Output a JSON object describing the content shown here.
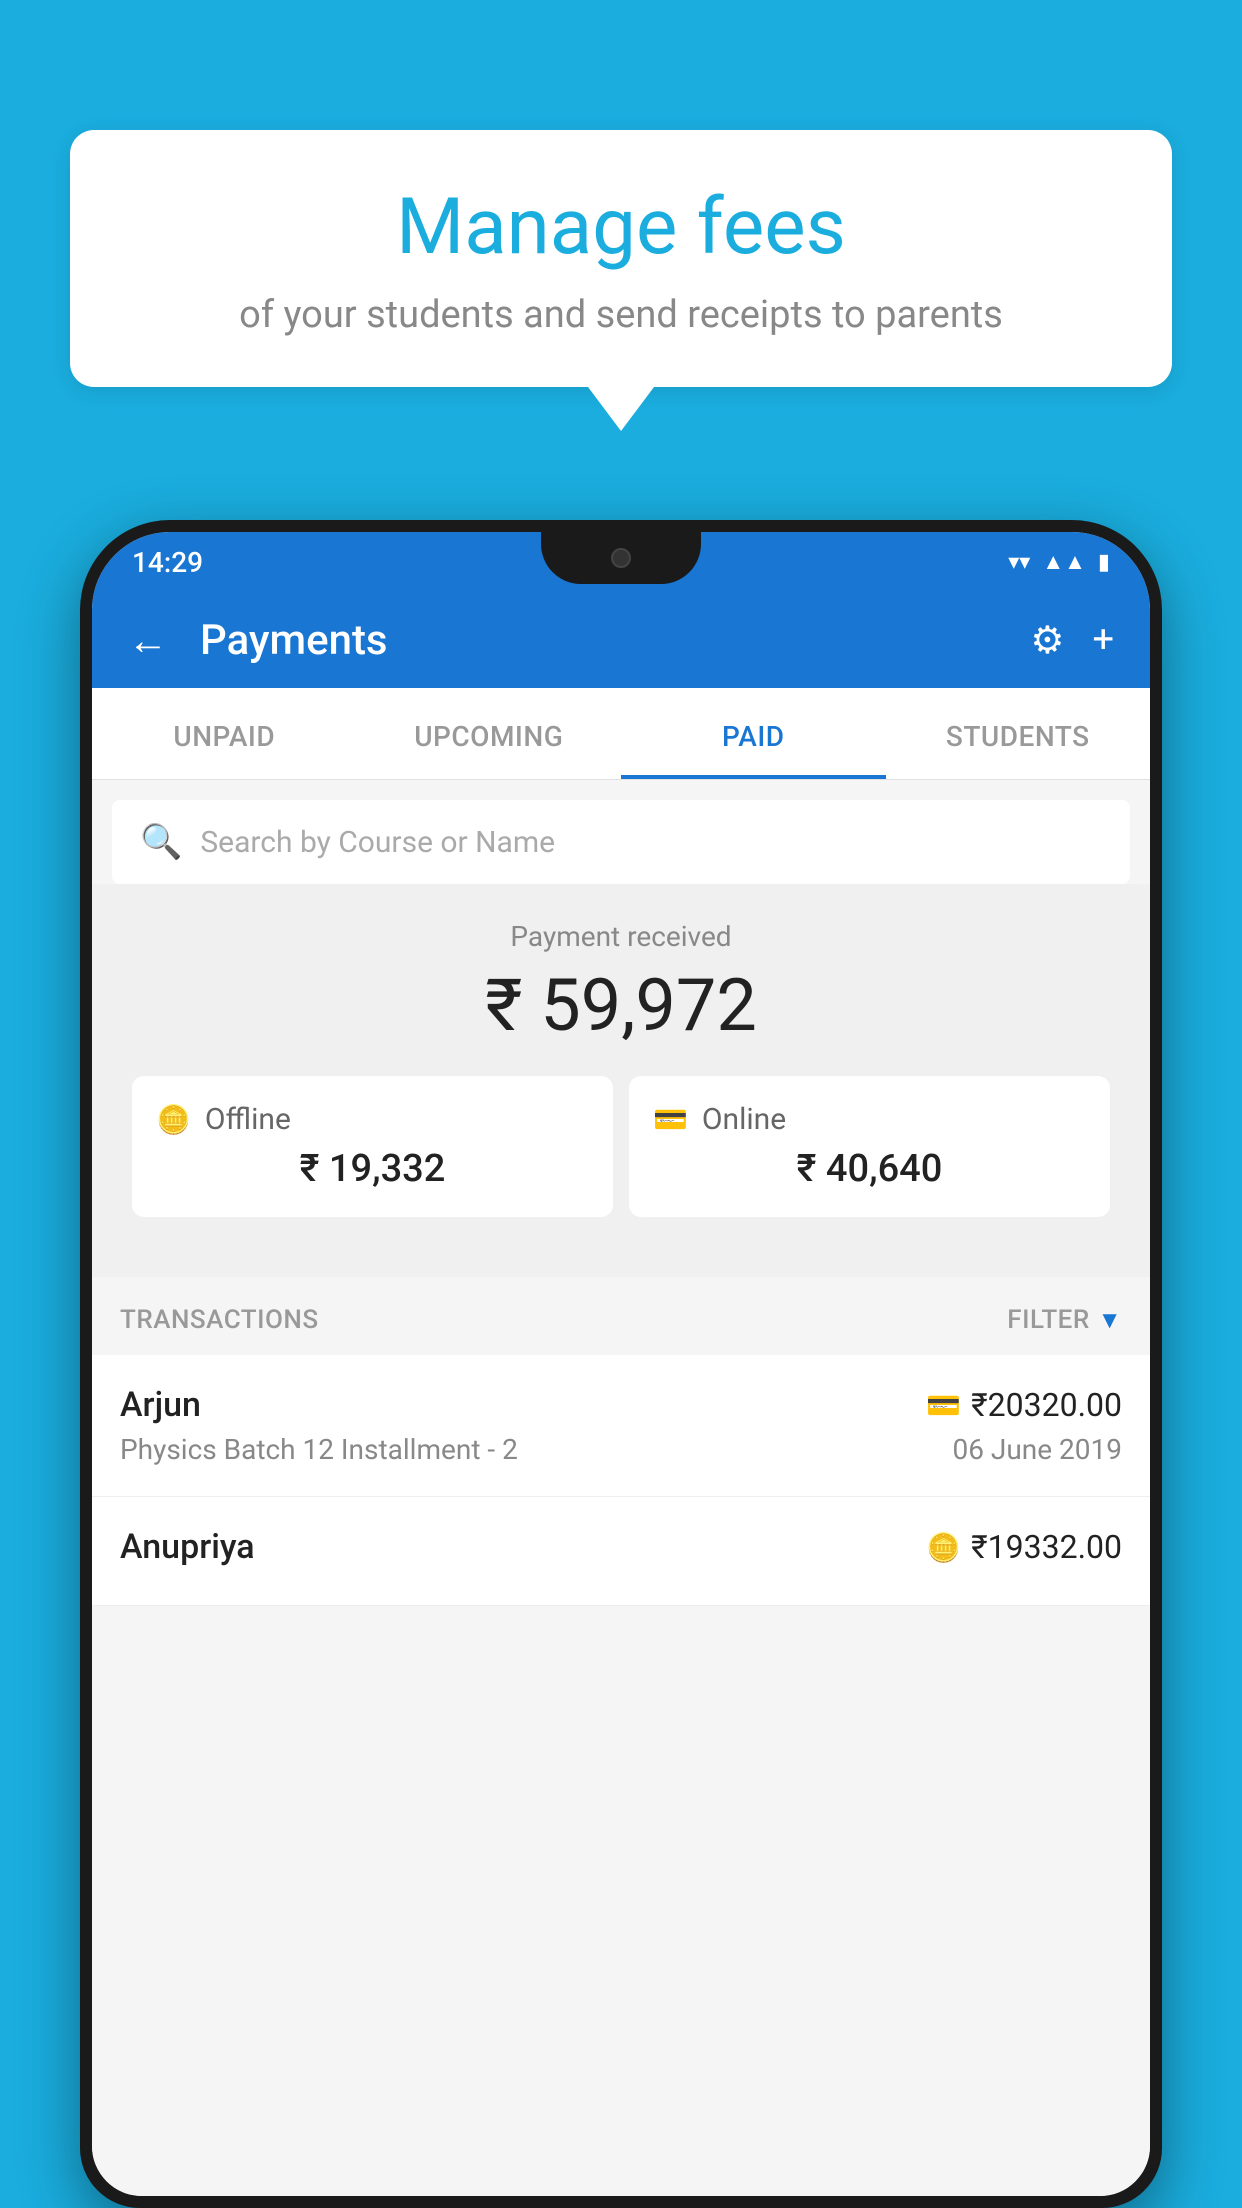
{
  "background_color": "#1AADDE",
  "bubble": {
    "title": "Manage fees",
    "subtitle": "of your students and send receipts to parents"
  },
  "phone": {
    "status_bar": {
      "time": "14:29",
      "icons": [
        "wifi",
        "signal",
        "battery"
      ]
    },
    "header": {
      "title": "Payments",
      "back_label": "←",
      "settings_label": "⚙",
      "add_label": "+"
    },
    "tabs": [
      {
        "label": "UNPAID",
        "active": false
      },
      {
        "label": "UPCOMING",
        "active": false
      },
      {
        "label": "PAID",
        "active": true
      },
      {
        "label": "STUDENTS",
        "active": false
      }
    ],
    "search": {
      "placeholder": "Search by Course or Name"
    },
    "payment_summary": {
      "label": "Payment received",
      "amount": "₹ 59,972",
      "offline": {
        "label": "Offline",
        "amount": "₹ 19,332"
      },
      "online": {
        "label": "Online",
        "amount": "₹ 40,640"
      }
    },
    "transactions": {
      "section_label": "TRANSACTIONS",
      "filter_label": "FILTER",
      "rows": [
        {
          "name": "Arjun",
          "course": "Physics Batch 12 Installment - 2",
          "amount": "₹20320.00",
          "date": "06 June 2019",
          "payment_type": "online"
        },
        {
          "name": "Anupriya",
          "course": "",
          "amount": "₹19332.00",
          "date": "",
          "payment_type": "offline"
        }
      ]
    }
  }
}
